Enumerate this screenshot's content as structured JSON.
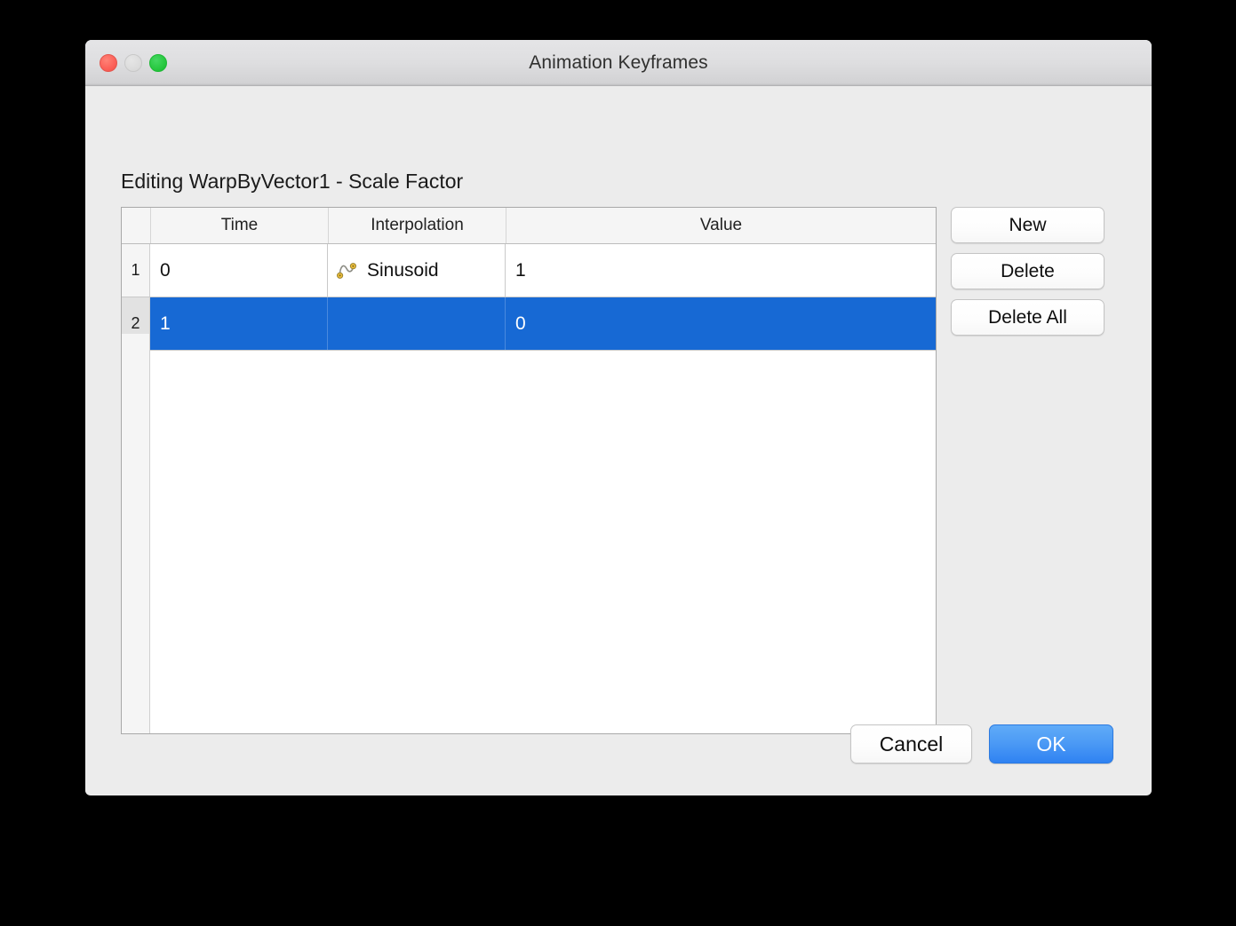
{
  "window": {
    "title": "Animation Keyframes",
    "controls": {
      "close": "close-button",
      "minimize": "minimize-button",
      "maximize": "maximize-button"
    }
  },
  "dialog": {
    "heading": "Editing WarpByVector1 - Scale Factor"
  },
  "table": {
    "columns": [
      "Time",
      "Interpolation",
      "Value"
    ],
    "rows": [
      {
        "index": "1",
        "time": "0",
        "interpolation": "Sinusoid",
        "interpolation_icon": "sinusoid-curve-icon",
        "value": "1",
        "selected": false
      },
      {
        "index": "2",
        "time": "1",
        "interpolation": "",
        "interpolation_icon": "",
        "value": "0",
        "selected": true
      }
    ]
  },
  "side_buttons": [
    {
      "label": "New",
      "name": "new-button"
    },
    {
      "label": "Delete",
      "name": "delete-button"
    },
    {
      "label": "Delete All",
      "name": "delete-all-button"
    }
  ],
  "footer": {
    "cancel_label": "Cancel",
    "ok_label": "OK"
  },
  "colors": {
    "selection_blue": "#1769D4",
    "ok_button_blue": "#2F82F2",
    "window_background": "#ECECEC",
    "titlebar_top": "#E5E5E7",
    "close_red": "#FC6058",
    "minimize_gray": "#DCDCDC",
    "maximize_green": "#28C840",
    "icon_dot_yellow": "#E8B42A"
  }
}
